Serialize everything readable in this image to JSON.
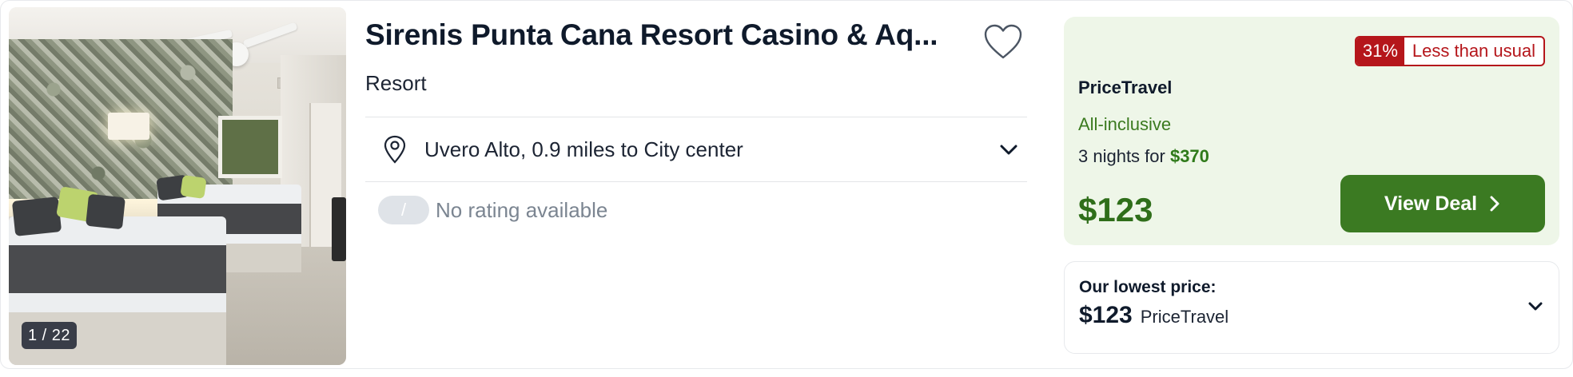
{
  "listing": {
    "photo_counter": "1 / 22",
    "title": "Sirenis Punta Cana Resort Casino & Aq...",
    "subtitle": "Resort",
    "location": "Uvero Alto, 0.9 miles to City center",
    "rating_pill": "/",
    "rating_text": "No rating available"
  },
  "deal": {
    "badge_percent": "31%",
    "badge_text": "Less than usual",
    "provider": "PriceTravel",
    "board": "All-inclusive",
    "nights_prefix": "3 nights for ",
    "nights_total": "$370",
    "price": "$123",
    "button_label": "View Deal"
  },
  "lowest": {
    "label": "Our lowest price:",
    "amount": "$123",
    "provider": "PriceTravel"
  },
  "colors": {
    "accent_green": "#3b7a22",
    "deal_bg": "#eef6e8",
    "badge_red": "#b5161b"
  },
  "icons": [
    "heart-icon",
    "map-pin-icon",
    "chevron-down-icon",
    "chevron-right-icon"
  ]
}
